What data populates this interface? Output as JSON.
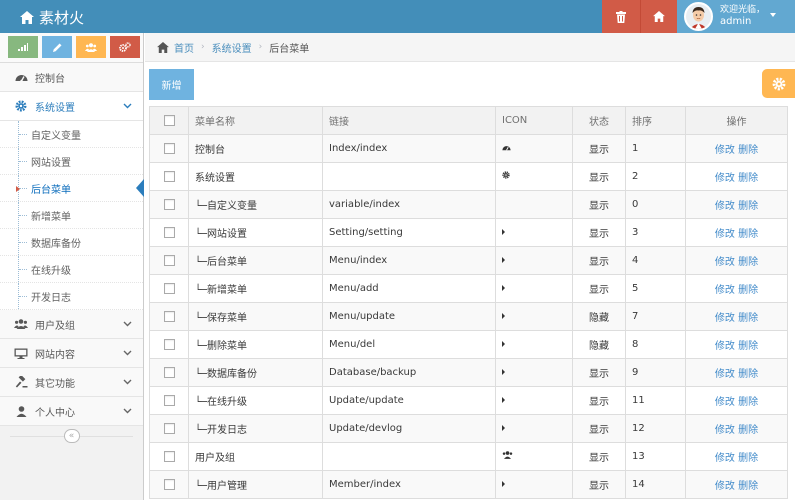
{
  "app": {
    "brand": "素材火"
  },
  "user": {
    "greeting": "欢迎光临，",
    "name": "admin"
  },
  "colors": {
    "navbar": "#438eb9",
    "danger": "#d15b47",
    "user_bg": "#62a8d1",
    "warning": "#ffb752",
    "primary": "#6fb3e0",
    "link": "#428bca"
  },
  "shortcuts": [
    {
      "icon": "signal-icon"
    },
    {
      "icon": "pencil-icon"
    },
    {
      "icon": "group-icon"
    },
    {
      "icon": "cogs-icon"
    }
  ],
  "sidebar": {
    "items": [
      {
        "label": "控制台",
        "icon": "dashboard-icon"
      },
      {
        "label": "系统设置",
        "icon": "gear-icon"
      },
      {
        "label": "用户及组",
        "icon": "users-icon"
      },
      {
        "label": "网站内容",
        "icon": "desktop-icon"
      },
      {
        "label": "其它功能",
        "icon": "gavel-icon"
      },
      {
        "label": "个人中心",
        "icon": "user-icon"
      }
    ],
    "submenu": [
      {
        "label": "自定义变量"
      },
      {
        "label": "网站设置"
      },
      {
        "label": "后台菜单"
      },
      {
        "label": "新增菜单"
      },
      {
        "label": "数据库备份"
      },
      {
        "label": "在线升级"
      },
      {
        "label": "开发日志"
      }
    ],
    "collapse_glyph": "«"
  },
  "breadcrumb": {
    "home": "首页",
    "section": "系统设置",
    "current": "后台菜单"
  },
  "toolbar": {
    "new_label": "新增"
  },
  "table": {
    "headers": {
      "name": "菜单名称",
      "link": "链接",
      "icon": "ICON",
      "state": "状态",
      "sort": "排序",
      "ops": "操作"
    },
    "edit_label": "修改",
    "delete_label": "删除",
    "rows": [
      {
        "name": "控制台",
        "link": "Index/index",
        "icon": "dashboard-icon",
        "state": "显示",
        "sort": "1"
      },
      {
        "name": "系统设置",
        "link": "",
        "icon": "gear-icon",
        "state": "显示",
        "sort": "2"
      },
      {
        "name": "└─自定义变量",
        "link": "variable/index",
        "icon": "",
        "state": "显示",
        "sort": "0"
      },
      {
        "name": "└─网站设置",
        "link": "Setting/setting",
        "icon": "caret-right-icon",
        "state": "显示",
        "sort": "3"
      },
      {
        "name": "└─后台菜单",
        "link": "Menu/index",
        "icon": "caret-right-icon",
        "state": "显示",
        "sort": "4"
      },
      {
        "name": "└─新增菜单",
        "link": "Menu/add",
        "icon": "caret-right-icon",
        "state": "显示",
        "sort": "5"
      },
      {
        "name": "└─保存菜单",
        "link": "Menu/update",
        "icon": "caret-right-icon",
        "state": "隐藏",
        "sort": "7"
      },
      {
        "name": "└─删除菜单",
        "link": "Menu/del",
        "icon": "caret-right-icon",
        "state": "隐藏",
        "sort": "8"
      },
      {
        "name": "└─数据库备份",
        "link": "Database/backup",
        "icon": "caret-right-icon",
        "state": "显示",
        "sort": "9"
      },
      {
        "name": "└─在线升级",
        "link": "Update/update",
        "icon": "caret-right-icon",
        "state": "显示",
        "sort": "11"
      },
      {
        "name": "└─开发日志",
        "link": "Update/devlog",
        "icon": "caret-right-icon",
        "state": "显示",
        "sort": "12"
      },
      {
        "name": "用户及组",
        "link": "",
        "icon": "users-icon",
        "state": "显示",
        "sort": "13"
      },
      {
        "name": "└─用户管理",
        "link": "Member/index",
        "icon": "caret-right-icon",
        "state": "显示",
        "sort": "14"
      }
    ]
  }
}
